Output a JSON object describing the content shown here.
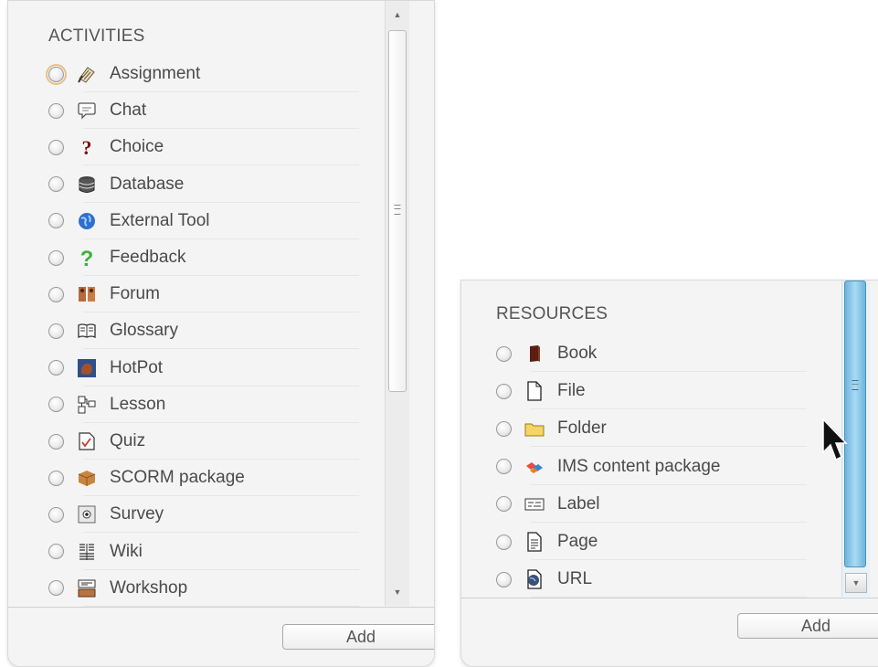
{
  "activities": {
    "heading": "ACTIVITIES",
    "add_label": "Add",
    "items": [
      {
        "label": "Assignment",
        "icon": "assignment-icon"
      },
      {
        "label": "Chat",
        "icon": "chat-icon"
      },
      {
        "label": "Choice",
        "icon": "choice-icon"
      },
      {
        "label": "Database",
        "icon": "database-icon"
      },
      {
        "label": "External Tool",
        "icon": "external-tool-icon"
      },
      {
        "label": "Feedback",
        "icon": "feedback-icon"
      },
      {
        "label": "Forum",
        "icon": "forum-icon"
      },
      {
        "label": "Glossary",
        "icon": "glossary-icon"
      },
      {
        "label": "HotPot",
        "icon": "hotpot-icon"
      },
      {
        "label": "Lesson",
        "icon": "lesson-icon"
      },
      {
        "label": "Quiz",
        "icon": "quiz-icon"
      },
      {
        "label": "SCORM package",
        "icon": "scorm-package-icon"
      },
      {
        "label": "Survey",
        "icon": "survey-icon"
      },
      {
        "label": "Wiki",
        "icon": "wiki-icon"
      },
      {
        "label": "Workshop",
        "icon": "workshop-icon"
      }
    ]
  },
  "resources": {
    "heading": "RESOURCES",
    "add_label": "Add",
    "items": [
      {
        "label": "Book",
        "icon": "book-icon"
      },
      {
        "label": "File",
        "icon": "file-icon"
      },
      {
        "label": "Folder",
        "icon": "folder-icon"
      },
      {
        "label": "IMS content package",
        "icon": "ims-content-package-icon"
      },
      {
        "label": "Label",
        "icon": "label-icon"
      },
      {
        "label": "Page",
        "icon": "page-icon"
      },
      {
        "label": "URL",
        "icon": "url-icon"
      }
    ]
  },
  "colors": {
    "scrollbar_active": "#8ec9ea",
    "focus_ring": "#e8c08a"
  }
}
